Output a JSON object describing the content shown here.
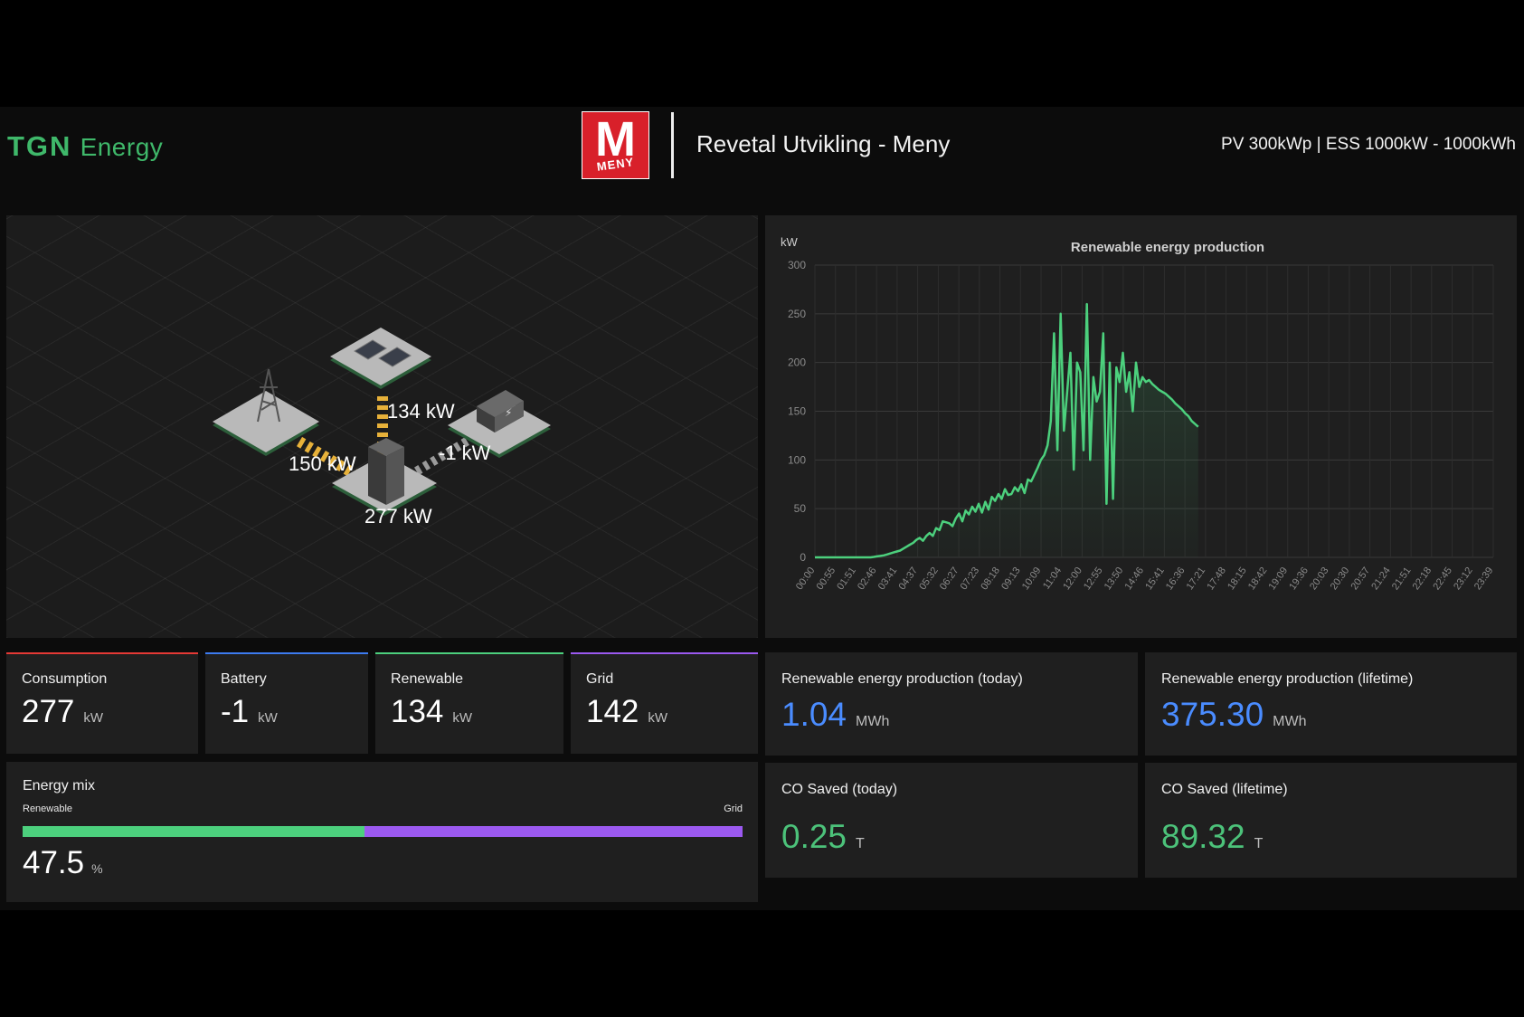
{
  "header": {
    "brand_part1": "TGN",
    "brand_part2": "Energy",
    "logo_letter": "M",
    "logo_word": "MENY",
    "site_title": "Revetal Utvikling - Meny",
    "site_spec": "PV 300kWp | ESS 1000kW - 1000kWh"
  },
  "diagram": {
    "solar_flow": "134 kW",
    "grid_flow": "150 kW",
    "battery_flow": "-1 kW",
    "consumption_flow": "277 kW"
  },
  "colors": {
    "accent_green": "#3fb86a",
    "consumption": "#e53935",
    "battery": "#3d7bf0",
    "renewable": "#4cd07d",
    "grid": "#9b59f0",
    "value_blue": "#4a8cff",
    "value_green": "#4cc27a"
  },
  "cards": {
    "consumption": {
      "label": "Consumption",
      "value": "277",
      "unit": "kW"
    },
    "battery": {
      "label": "Battery",
      "value": "-1",
      "unit": "kW"
    },
    "renewable": {
      "label": "Renewable",
      "value": "134",
      "unit": "kW"
    },
    "grid": {
      "label": "Grid",
      "value": "142",
      "unit": "kW"
    }
  },
  "energy_mix": {
    "label": "Energy mix",
    "left_label": "Renewable",
    "right_label": "Grid",
    "renewable_fraction": 0.475,
    "value": "47.5",
    "unit": "%"
  },
  "kpis": {
    "prod_today": {
      "label": "Renewable energy production (today)",
      "value": "1.04",
      "unit": "MWh"
    },
    "prod_lifetime": {
      "label": "Renewable energy production (lifetime)",
      "value": "375.30",
      "unit": "MWh"
    },
    "co_today": {
      "label": "CO Saved (today)",
      "value": "0.25",
      "unit": "T"
    },
    "co_lifetime": {
      "label": "CO Saved (lifetime)",
      "value": "89.32",
      "unit": "T"
    }
  },
  "chart_data": {
    "type": "area",
    "title": "Renewable energy production",
    "ylabel": "kW",
    "xlabel": "",
    "ylim": [
      0,
      300
    ],
    "yticks": [
      0,
      50,
      100,
      150,
      200,
      250,
      300
    ],
    "grid": true,
    "categories": [
      "00:00",
      "00:55",
      "01:51",
      "02:46",
      "03:41",
      "04:37",
      "05:32",
      "06:27",
      "07:23",
      "08:18",
      "09:13",
      "10:09",
      "11:04",
      "12:00",
      "12:55",
      "13:50",
      "14:46",
      "15:41",
      "16:36",
      "17:21",
      "17:48",
      "18:15",
      "18:42",
      "19:09",
      "19:36",
      "20:03",
      "20:30",
      "20:57",
      "21:24",
      "21:51",
      "22:18",
      "22:45",
      "23:12",
      "23:39"
    ],
    "series": [
      {
        "values": [
          0,
          0,
          0,
          0,
          0,
          0,
          0,
          0,
          0,
          0,
          0,
          0,
          0,
          0,
          0,
          0,
          0,
          0,
          0.5,
          1,
          1.5,
          2,
          3,
          4,
          5,
          6,
          7,
          9,
          11,
          13,
          15,
          18,
          20,
          17,
          22,
          25,
          22,
          30,
          28,
          37,
          36,
          35,
          32,
          40,
          45,
          37,
          48,
          44,
          52,
          47,
          55,
          46,
          57,
          49,
          62,
          58,
          65,
          60,
          70,
          64,
          65,
          72,
          68,
          75,
          66,
          80,
          78,
          85,
          92,
          100,
          105,
          115,
          140,
          230,
          110,
          250,
          130,
          170,
          210,
          90,
          200,
          190,
          110,
          260,
          100,
          185,
          160,
          170,
          230,
          55,
          200,
          60,
          195,
          180,
          210,
          170,
          190,
          150,
          200,
          175,
          185,
          180,
          182,
          178,
          175,
          172,
          170,
          168,
          165,
          162,
          158,
          155,
          152,
          148,
          145,
          140,
          137,
          134
        ]
      }
    ]
  }
}
